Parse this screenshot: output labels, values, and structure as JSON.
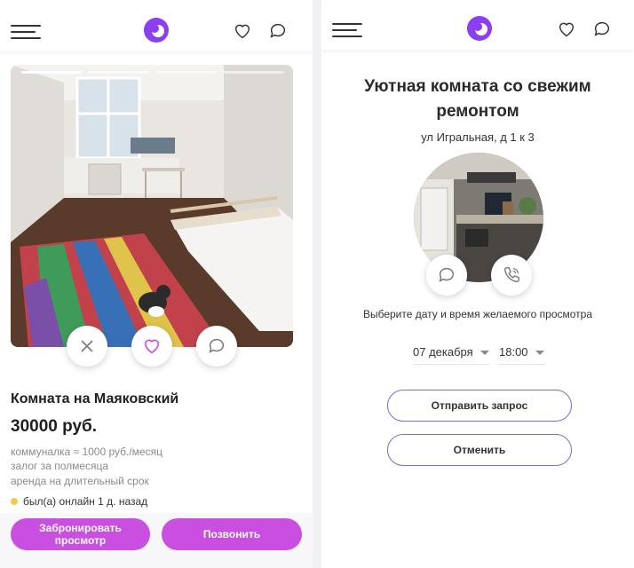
{
  "listing": {
    "title": "Комната на Маяковский",
    "price": "30000 руб.",
    "details": [
      "коммуналка ≈ 1000 руб./месяц",
      "залог за полмесяца",
      "аренда на длительный срок"
    ],
    "status": "был(а) онлайн 1 д. назад",
    "book_label": "Забронировать просмотр",
    "call_label": "Позвонить",
    "photo_progress": {
      "current": 1,
      "total": 4
    }
  },
  "booking": {
    "title": "Уютная комната со свежим ремонтом",
    "address": "ул Игральная, д 1 к 3",
    "hint": "Выберите дату и время желаемого просмотра",
    "date_value": "07 декабря",
    "time_value": "18:00",
    "send_label": "Отправить запрос",
    "cancel_label": "Отменить"
  },
  "colors": {
    "accent": "#c84fe0",
    "logo": "#8a3ff0",
    "outline": "#7c6cd3",
    "online_dot": "#f2c94c"
  },
  "icons": [
    "menu-icon",
    "logo-icon",
    "heart-icon",
    "chat-icon",
    "close-icon",
    "phone-icon"
  ]
}
